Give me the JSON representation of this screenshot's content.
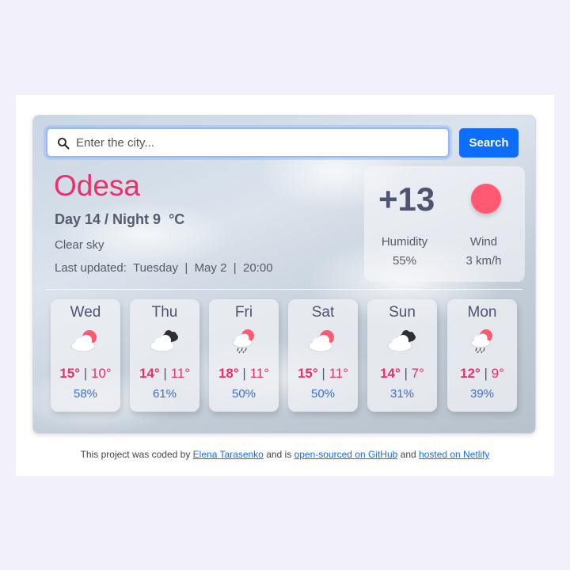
{
  "search": {
    "placeholder": "Enter the city...",
    "button_label": "Search"
  },
  "current": {
    "city": "Odesa",
    "day_night": "Day 14 / Night 9",
    "unit": "°C",
    "description": "Clear sky",
    "updated_label": "Last updated:",
    "updated_day": "Tuesday",
    "updated_date": "May 2",
    "updated_time": "20:00",
    "temperature": "+13",
    "icon": "sun-icon",
    "humidity_label": "Humidity",
    "humidity_value": "55%",
    "wind_label": "Wind",
    "wind_value": "3 km/h"
  },
  "forecast": [
    {
      "day": "Wed",
      "high": "15°",
      "low": "10°",
      "humidity": "58%",
      "icon": "partly-cloudy-icon"
    },
    {
      "day": "Thu",
      "high": "14°",
      "low": "11°",
      "humidity": "61%",
      "icon": "dark-clouds-icon"
    },
    {
      "day": "Fri",
      "high": "18°",
      "low": "11°",
      "humidity": "50%",
      "icon": "sun-rain-icon"
    },
    {
      "day": "Sat",
      "high": "15°",
      "low": "11°",
      "humidity": "50%",
      "icon": "partly-cloudy-icon"
    },
    {
      "day": "Sun",
      "high": "14°",
      "low": "7°",
      "humidity": "31%",
      "icon": "dark-clouds-icon"
    },
    {
      "day": "Mon",
      "high": "12°",
      "low": "9°",
      "humidity": "39%",
      "icon": "sun-rain-icon"
    }
  ],
  "footer": {
    "text_1": "This project was coded by ",
    "author_link": "Elena Tarasenko",
    "text_2": " and is ",
    "github_link": "open-sourced on GitHub",
    "text_3": " and ",
    "netlify_link": "hosted on Netlify"
  },
  "colors": {
    "accent": "#ee2d6b",
    "button": "#0d6efd",
    "sun": "#ff5a72",
    "humidity": "#3d6dcc"
  }
}
